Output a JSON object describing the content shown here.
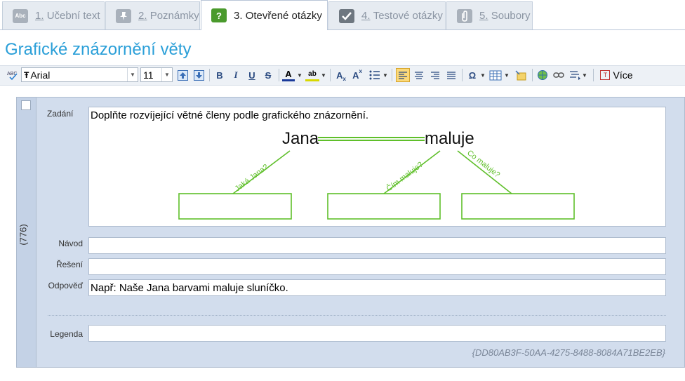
{
  "tabs": [
    {
      "number": "1.",
      "label": "Učební text",
      "icon": "abc-icon"
    },
    {
      "number": "2.",
      "label": "Poznámky",
      "icon": "pin-icon"
    },
    {
      "number": "3.",
      "label": "Otevřené otázky",
      "icon": "question-icon"
    },
    {
      "number": "4.",
      "label": "Testové otázky",
      "icon": "checkmark-icon"
    },
    {
      "number": "5.",
      "label": "Soubory",
      "icon": "paperclip-icon"
    }
  ],
  "icon_glyphs": {
    "abc": "Abc",
    "question": "?"
  },
  "page_title": "Grafické znázornění věty",
  "toolbar": {
    "font": "Arial",
    "size": "11",
    "bold": "B",
    "italic": "I",
    "underline": "U",
    "strike": "S",
    "font_color": "A",
    "highlight": "ab",
    "subscript": "A",
    "superscript": "A",
    "omega": "Ω",
    "more_label": "Více"
  },
  "question": {
    "number": "(776)",
    "labels": {
      "zadani": "Zadání",
      "navod": "Návod",
      "reseni": "Řešení",
      "odpoved": "Odpověď",
      "legenda": "Legenda"
    },
    "zadani_text": "Doplňte rozvíjející větné členy podle grafického znázornění.",
    "diagram": {
      "subject": "Jana",
      "predicate": "maluje",
      "q1": "Jaká Jana?",
      "q2": "Čím maluje?",
      "q3": "Co maluje?"
    },
    "navod_value": "",
    "reseni_value": "",
    "odpoved_value": "Např: Naše Jana barvami maluje sluníčko.",
    "legenda_value": "",
    "guid": "{DD80AB3F-50AA-4275-8488-8084A71BE2EB}"
  },
  "colors": {
    "accent": "#2a9fd8",
    "diagram_green": "#5fbf2a"
  }
}
